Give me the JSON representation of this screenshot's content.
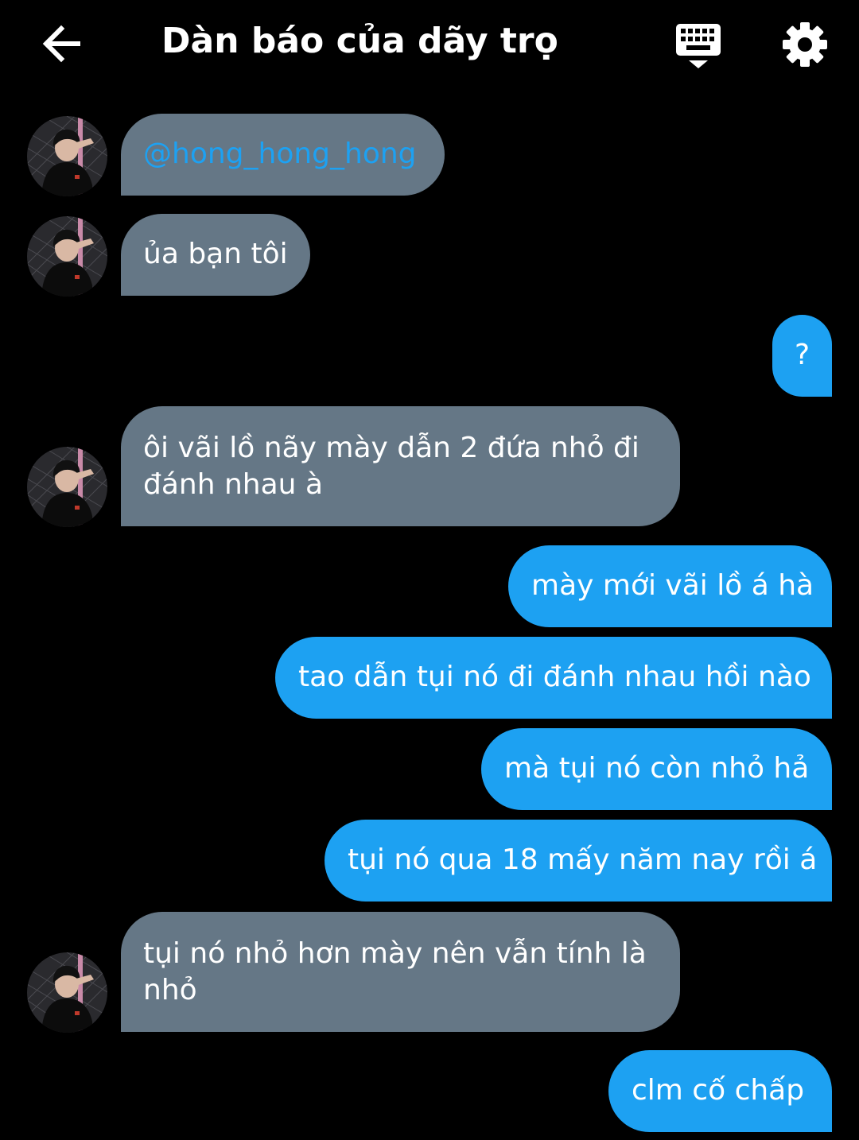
{
  "header": {
    "title": "Dàn báo của dãy trọ",
    "back_icon": "arrow-left-icon",
    "keyboard_icon": "keyboard-icon",
    "settings_icon": "gear-icon"
  },
  "colors": {
    "background": "#000000",
    "incoming_bubble": "#657786",
    "outgoing_bubble": "#1da1f2",
    "mention": "#1da1f2"
  },
  "messages": [
    {
      "direction": "incoming",
      "text": "@hong_hong_hong",
      "is_mention": true
    },
    {
      "direction": "incoming",
      "text": "ủa bạn tôi"
    },
    {
      "direction": "outgoing",
      "text": "?"
    },
    {
      "direction": "incoming",
      "lines": [
        "ôi vãi lồ nãy mày dẫn 2 đứa nhỏ đi",
        "đánh nhau à"
      ]
    },
    {
      "direction": "outgoing",
      "text": "mày mới vãi lồ á hà"
    },
    {
      "direction": "outgoing",
      "text": "tao dẫn tụi nó đi đánh nhau hồi nào"
    },
    {
      "direction": "outgoing",
      "text": "mà tụi nó còn nhỏ hả"
    },
    {
      "direction": "outgoing",
      "text": "tụi nó qua 18 mấy năm nay rồi á"
    },
    {
      "direction": "incoming",
      "lines": [
        "tụi nó nhỏ hơn mày nên vẫn tính là",
        "nhỏ"
      ]
    },
    {
      "direction": "outgoing",
      "text": "clm cố chấp"
    }
  ]
}
